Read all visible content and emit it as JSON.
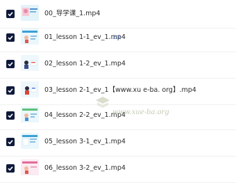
{
  "files": [
    {
      "name": "00_导学课_1.mp4",
      "checked": true,
      "thumb": "cover"
    },
    {
      "name": "01_lesson 1-1_ev_1.mp4",
      "checked": true,
      "tag": "上次",
      "thumb": "slide"
    },
    {
      "name": "02_lesson 1-2_ev_1.mp4",
      "checked": true,
      "thumb": "slide"
    },
    {
      "name": "03_lesson 2-1_ev_1【www.xu e-ba. org】.mp4",
      "checked": true,
      "thumb": "slide"
    },
    {
      "name": "04_lesson 2-2_ev_1.mp4",
      "checked": true,
      "thumb": "slide"
    },
    {
      "name": "05_lesson 3-1_ev_1.mp4",
      "checked": true,
      "thumb": "slide"
    },
    {
      "name": "06_lesson 3-2_ev_1.mp4",
      "checked": true,
      "thumb": "slide-pink"
    }
  ],
  "watermark": {
    "text": "www.xue-ba.org"
  },
  "colors": {
    "checkbox": "#0f1a3a",
    "tag": "#3a6fd8",
    "thumb_bg": "#e8f6fb"
  }
}
